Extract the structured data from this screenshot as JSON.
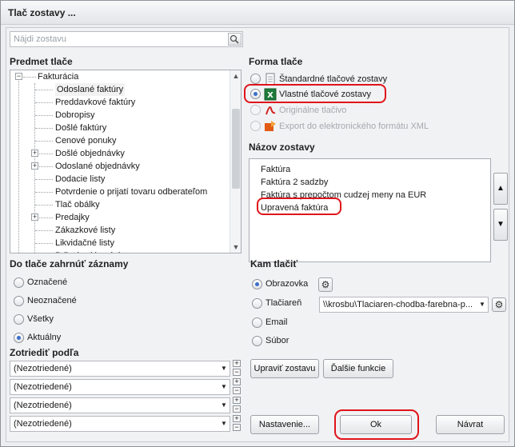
{
  "window": {
    "title": "Tlač zostavy ..."
  },
  "search": {
    "placeholder": "Nájdi zostavu",
    "icon": "search-icon"
  },
  "subject": {
    "header": "Predmet tlače",
    "root": "Fakturácia",
    "items": [
      {
        "label": "Odoslané faktúry",
        "selected": true,
        "expandable": false
      },
      {
        "label": "Preddavkové faktúry",
        "expandable": false
      },
      {
        "label": "Dobropisy",
        "expandable": false
      },
      {
        "label": "Došlé faktúry",
        "expandable": false
      },
      {
        "label": "Cenové ponuky",
        "expandable": false
      },
      {
        "label": "Došlé objednávky",
        "expandable": true
      },
      {
        "label": "Odoslané objednávky",
        "expandable": true
      },
      {
        "label": "Dodacie listy",
        "expandable": false
      },
      {
        "label": "Potvrdenie o prijatí tovaru odberateľom",
        "expandable": false
      },
      {
        "label": "Tlač obálky",
        "expandable": false
      },
      {
        "label": "Predajky",
        "expandable": true
      },
      {
        "label": "Zákazkové listy",
        "expandable": false
      },
      {
        "label": "Likvidačné listy",
        "expandable": false
      },
      {
        "label": "Prijaté reklamácie",
        "expandable": false
      }
    ]
  },
  "form": {
    "header": "Forma tlače",
    "options": [
      {
        "label": "Štandardné tlačové zostavy",
        "checked": false,
        "disabled": false,
        "icon": "standard-report-icon"
      },
      {
        "label": "Vlastné tlačové zostavy",
        "checked": true,
        "disabled": false,
        "icon": "excel-report-icon"
      },
      {
        "label": "Originálne tlačivo",
        "checked": false,
        "disabled": true,
        "icon": "pdf-form-icon"
      },
      {
        "label": "Export do elektronického formátu XML",
        "checked": false,
        "disabled": true,
        "icon": "xml-export-icon"
      }
    ]
  },
  "report_name": {
    "header": "Názov zostavy",
    "items": [
      "Faktúra",
      "Faktúra 2 sadzby",
      "Faktúra s prepočtom cudzej meny na EUR",
      "Upravená faktúra"
    ]
  },
  "include": {
    "header": "Do tlače zahrnúť záznamy",
    "options": [
      {
        "label": "Označené",
        "checked": false
      },
      {
        "label": "Neoznačené",
        "checked": false
      },
      {
        "label": "Všetky",
        "checked": false
      },
      {
        "label": "Aktuálny",
        "checked": true
      }
    ]
  },
  "sort": {
    "header": "Zotriediť podľa",
    "combos": [
      "(Nezotriedené)",
      "(Nezotriedené)",
      "(Nezotriedené)",
      "(Nezotriedené)"
    ]
  },
  "target": {
    "header": "Kam tlačiť",
    "options": [
      {
        "label": "Obrazovka",
        "checked": true
      },
      {
        "label": "Tlačiareň",
        "checked": false
      },
      {
        "label": "Email",
        "checked": false
      },
      {
        "label": "Súbor",
        "checked": false
      }
    ],
    "printer": "\\\\krosbu\\Tlaciaren-chodba-farebna-p..."
  },
  "buttons": {
    "edit": "Upraviť zostavu",
    "more": "Ďalšie funkcie",
    "settings": "Nastavenie...",
    "ok": "Ok",
    "back": "Návrat"
  },
  "colors": {
    "highlight": "#e0141a",
    "accent": "#3a6fc8"
  }
}
